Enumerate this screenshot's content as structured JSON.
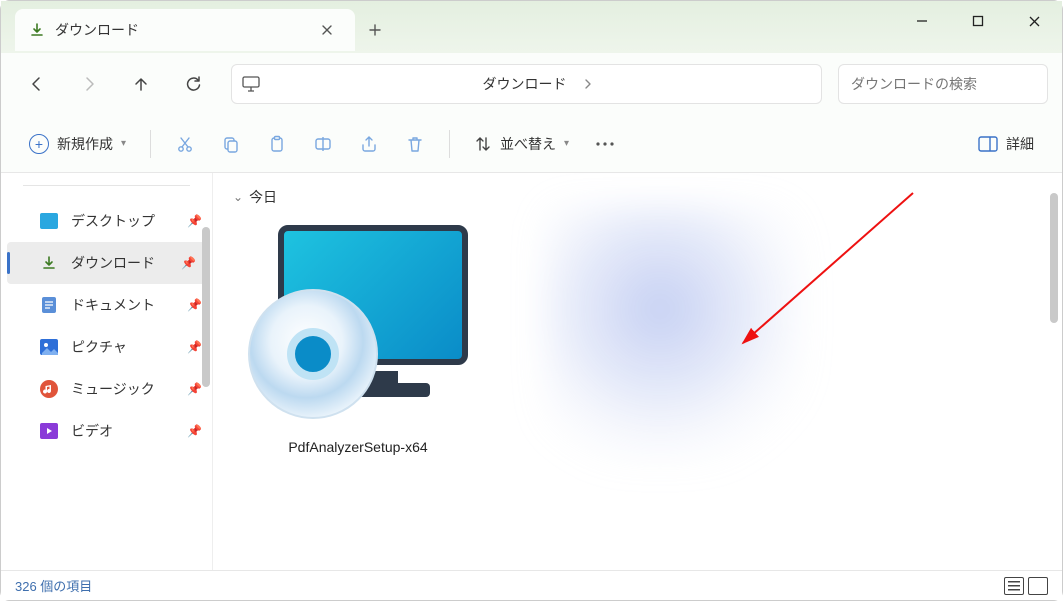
{
  "tab": {
    "title": "ダウンロード"
  },
  "addressbar": {
    "location": "ダウンロード"
  },
  "search": {
    "placeholder": "ダウンロードの検索"
  },
  "toolbar": {
    "new_label": "新規作成",
    "sort_label": "並べ替え",
    "details_label": "詳細"
  },
  "sidebar": {
    "items": [
      {
        "label": "デスクトップ",
        "icon": "desktop",
        "selected": false
      },
      {
        "label": "ダウンロード",
        "icon": "download",
        "selected": true
      },
      {
        "label": "ドキュメント",
        "icon": "document",
        "selected": false
      },
      {
        "label": "ピクチャ",
        "icon": "pictures",
        "selected": false
      },
      {
        "label": "ミュージック",
        "icon": "music",
        "selected": false
      },
      {
        "label": "ビデオ",
        "icon": "video",
        "selected": false
      }
    ]
  },
  "content": {
    "group_label": "今日",
    "items": [
      {
        "name": "PdfAnalyzerSetup-x64",
        "type": "installer"
      }
    ]
  },
  "statusbar": {
    "text": "326 個の項目"
  }
}
